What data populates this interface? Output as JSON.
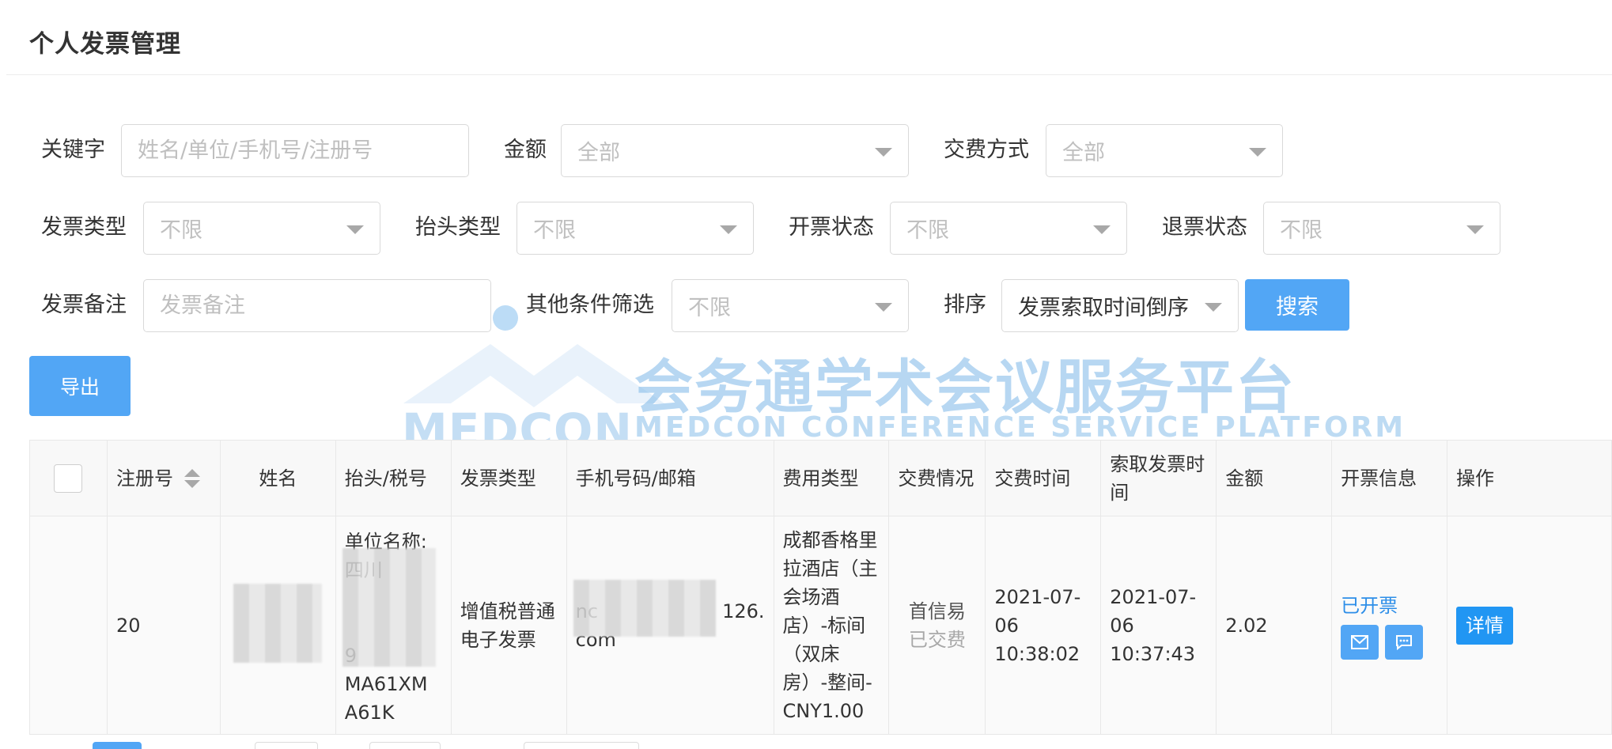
{
  "page": {
    "title": "个人发票管理"
  },
  "filters": {
    "keyword": {
      "label": "关键字",
      "placeholder": "姓名/单位/手机号/注册号"
    },
    "amount": {
      "label": "金额",
      "value": "全部"
    },
    "payment_method": {
      "label": "交费方式",
      "value": "全部"
    },
    "invoice_type": {
      "label": "发票类型",
      "value": "不限"
    },
    "header_type": {
      "label": "抬头类型",
      "value": "不限"
    },
    "issue_status": {
      "label": "开票状态",
      "value": "不限"
    },
    "refund_status": {
      "label": "退票状态",
      "value": "不限"
    },
    "invoice_note": {
      "label": "发票备注",
      "placeholder": "发票备注"
    },
    "other_conditions": {
      "label": "其他条件筛选",
      "value": "不限"
    },
    "sort": {
      "label": "排序",
      "value": "发票索取时间倒序"
    },
    "search_button": "搜索"
  },
  "toolbar": {
    "export_button": "导出"
  },
  "watermark": {
    "logo_text": "MEDCON",
    "title_cn": "会务通学术会议服务平台",
    "title_en": "MEDCON CONFERENCE SERVICE PLATFORM"
  },
  "table": {
    "columns": [
      "注册号",
      "姓名",
      "抬头/税号",
      "发票类型",
      "手机号码/邮箱",
      "费用类型",
      "交费情况",
      "交费时间",
      "索取发票时间",
      "金额",
      "开票信息",
      "操作"
    ],
    "rows": [
      {
        "reg_no": "20",
        "header_line1": "单位名称:",
        "header_line2": "四川",
        "header_line3": "9",
        "header_line4": "MA61XM",
        "header_line5": "A61K",
        "invoice_type": "增值税普通电子发票",
        "contact_prefix": "nc",
        "contact_suffix": "126.",
        "contact_tail": "com",
        "fee_type": "成都香格里拉酒店（主会场酒店）-标间（双床房）-整间-CNY1.00",
        "payment_channel": "首信易",
        "payment_status": "已交费",
        "paid_time": "2021-07-06 10:38:02",
        "request_time": "2021-07-06 10:37:43",
        "amount": "2.02",
        "issue_status": "已开票",
        "detail_button": "详情"
      }
    ]
  },
  "colors": {
    "primary": "#52a6f5",
    "link": "#2d8ee8",
    "detail": "#2196f3"
  }
}
